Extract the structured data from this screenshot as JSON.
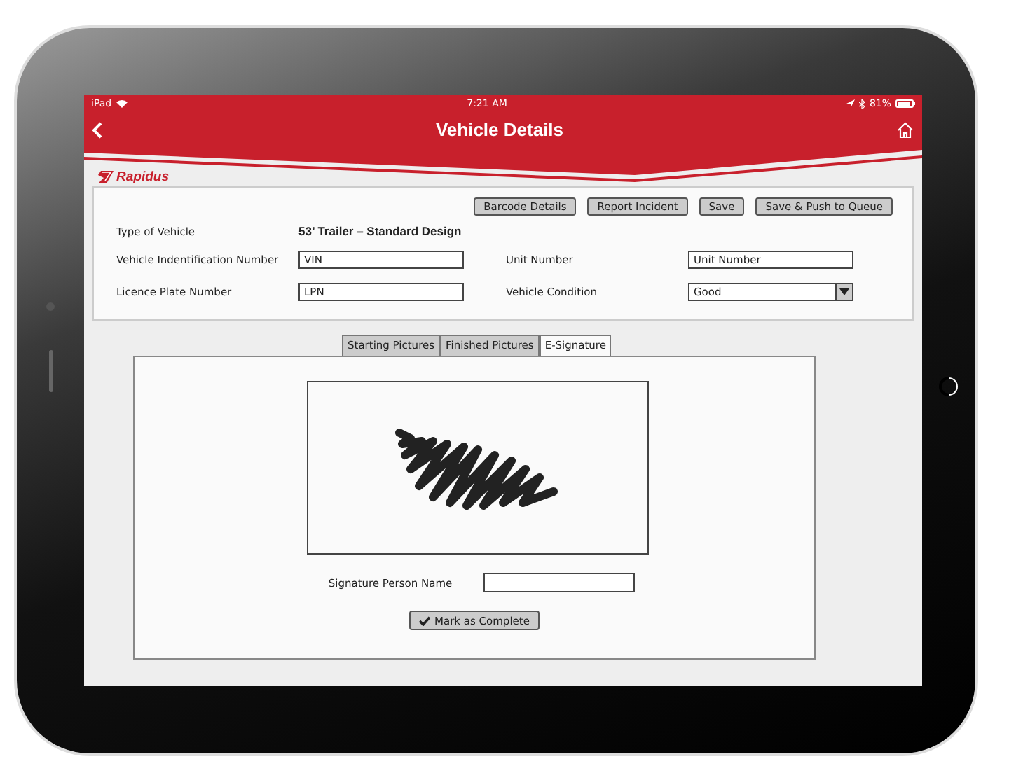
{
  "status_bar": {
    "device": "iPad",
    "time": "7:21 AM",
    "battery": "81%"
  },
  "header": {
    "title": "Vehicle Details"
  },
  "brand": {
    "name": "Rapidus"
  },
  "toolbar": {
    "buttons": [
      "Barcode Details",
      "Report Incident",
      "Save",
      "Save & Push to Queue"
    ]
  },
  "vehicle_type": {
    "label": "Type of Vehicle",
    "value": "53’ Trailer – Standard Design"
  },
  "fields": [
    {
      "kind": "text",
      "label": "Vehicle Indentification Number",
      "value": "VIN"
    },
    {
      "kind": "text",
      "label": "Unit Number",
      "value": "Unit Number"
    },
    {
      "kind": "text",
      "label": "Licence Plate Number",
      "value": "LPN"
    },
    {
      "kind": "select",
      "label": "Vehicle Condition",
      "value": "Good"
    }
  ],
  "tabs": [
    {
      "label": "Starting Pictures",
      "selected": false
    },
    {
      "label": "Finished Pictures",
      "selected": false
    },
    {
      "label": "E-Signature",
      "selected": true
    }
  ],
  "signature": {
    "label": "Signature Person Name"
  },
  "complete_button": {
    "label": "Mark as Complete"
  }
}
